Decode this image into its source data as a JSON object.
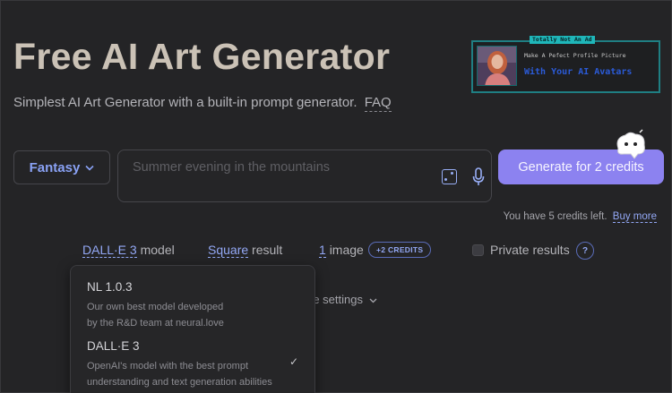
{
  "header": {
    "title": "Free AI Art Generator",
    "subtitle": "Simplest AI Art Generator with a built-in prompt generator.",
    "faq_link": "FAQ"
  },
  "ad": {
    "tag": "Totally Not An Ad",
    "line1": "Make A Pefect Profile Picture",
    "line2": "With Your AI Avatars"
  },
  "prompt": {
    "style_label": "Fantasy",
    "placeholder": "Summer evening in the mountains",
    "generate_label": "Generate for 2 credits"
  },
  "credits": {
    "text": "You have 5 credits left.",
    "buy_link": "Buy more"
  },
  "options": {
    "model_value": "DALL·E 3",
    "model_suffix": "model",
    "aspect_value": "Square",
    "aspect_suffix": "result",
    "count_value": "1",
    "count_suffix": "image",
    "credits_badge": "+2 CREDITS",
    "private_label": "Private results",
    "help_label": "?",
    "more_settings": "re settings"
  },
  "model_menu": {
    "items": [
      {
        "name": "NL 1.0.3",
        "desc1": "Our own best model developed",
        "desc2": "by the R&D team at neural.love",
        "selected": false
      },
      {
        "name": "DALL·E 3",
        "desc1": "OpenAI's model with the best prompt",
        "desc2": "understanding and text generation abilities",
        "selected": true
      }
    ]
  },
  "icons": {
    "style_chevron": "chevron-down-icon",
    "dice": "dice-icon",
    "mic": "microphone-icon",
    "mascot": "mascot-icon",
    "check": "checkmark-icon"
  },
  "colors": {
    "accent": "#8c82f0",
    "link": "#93a8f5",
    "background": "#242426",
    "ad_teal": "#1fb6b9"
  }
}
